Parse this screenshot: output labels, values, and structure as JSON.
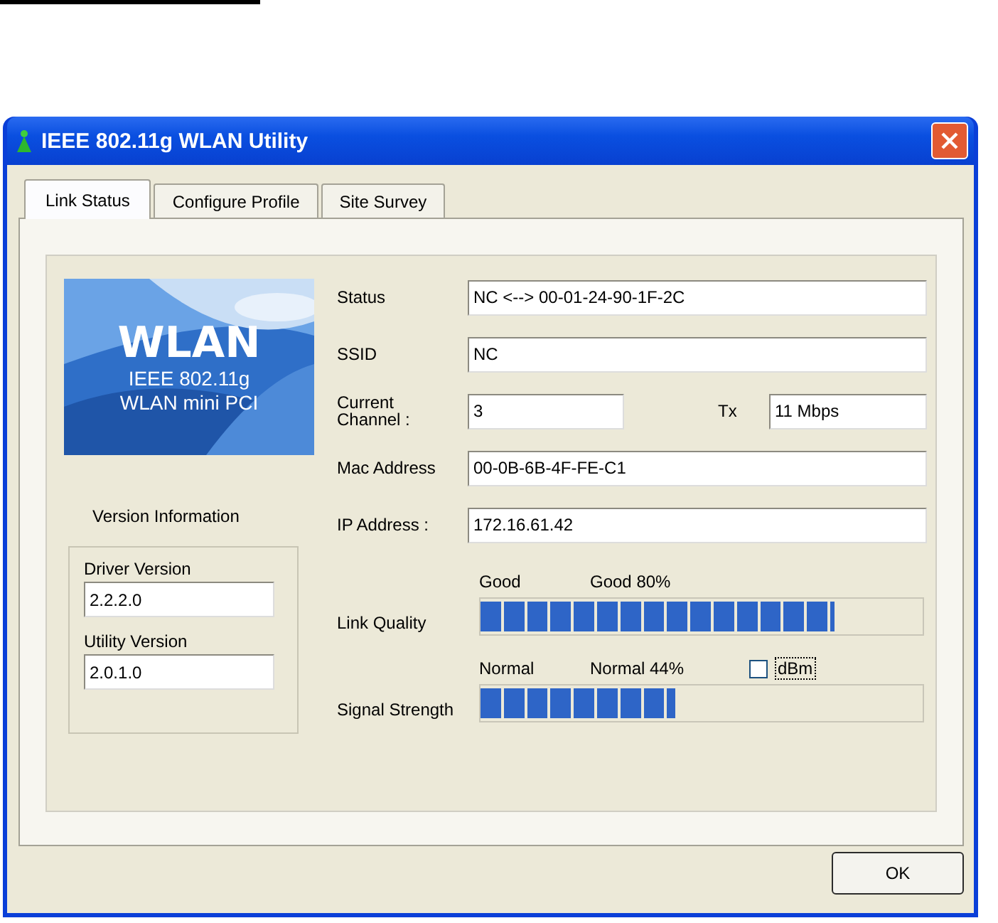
{
  "window": {
    "title": "IEEE 802.11g WLAN Utility"
  },
  "tabs": [
    {
      "label": "Link Status",
      "selected": true
    },
    {
      "label": "Configure Profile",
      "selected": false
    },
    {
      "label": "Site Survey",
      "selected": false
    }
  ],
  "banner": {
    "title": "WLAN",
    "lines": [
      "IEEE 802.11g",
      "WLAN mini PCI"
    ]
  },
  "version_info": {
    "title": "Version Information",
    "fields": [
      {
        "label": "Driver Version",
        "value": "2.2.2.0"
      },
      {
        "label": "Utility Version",
        "value": "2.0.1.0"
      }
    ]
  },
  "status": {
    "label": "Status",
    "value": "NC <--> 00-01-24-90-1F-2C"
  },
  "ssid": {
    "label": "SSID",
    "value": "NC"
  },
  "channel": {
    "label": "Current Channel :",
    "value": "3",
    "tx_label": "Tx",
    "tx_value": "11 Mbps"
  },
  "mac": {
    "label": "Mac Address",
    "value": "00-0B-6B-4F-FE-C1"
  },
  "ip": {
    "label": "IP Address :",
    "value": "172.16.61.42"
  },
  "meters": [
    {
      "label": "Link Quality",
      "state": "Good",
      "reading": "Good 80%",
      "level": 0.8
    },
    {
      "label": "Signal Strength",
      "state": "Normal",
      "reading": "Normal 44%",
      "level": 0.44
    }
  ],
  "dbm": {
    "label": "dBm",
    "checked": false
  },
  "buttons": [
    "OK"
  ]
}
